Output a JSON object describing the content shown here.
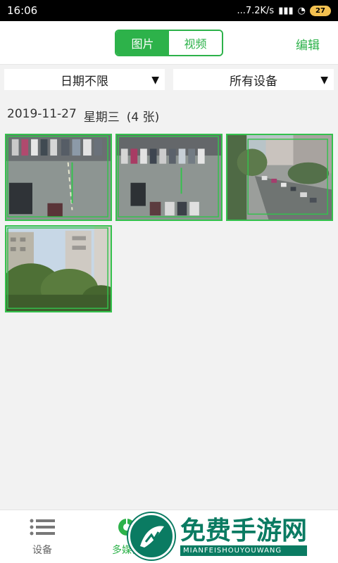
{
  "status_bar": {
    "time": "16:06",
    "network_speed": "...7.2K/s",
    "battery_level": "27"
  },
  "header": {
    "tabs": [
      {
        "label": "图片",
        "active": true
      },
      {
        "label": "视频",
        "active": false
      }
    ],
    "edit_label": "编辑"
  },
  "filters": {
    "date_filter": "日期不限",
    "device_filter": "所有设备"
  },
  "gallery": {
    "date": "2019-11-27",
    "weekday": "星期三",
    "count_label": "(4 张)",
    "items": [
      {
        "type": "photo",
        "scene": "parking-lot"
      },
      {
        "type": "photo",
        "scene": "parking-lot"
      },
      {
        "type": "photo",
        "scene": "street-buildings"
      },
      {
        "type": "photo",
        "scene": "buildings-trees"
      }
    ]
  },
  "bottom_nav": {
    "items": [
      {
        "label": "设备",
        "icon": "list-icon",
        "active": false
      },
      {
        "label": "多媒体",
        "icon": "media-icon",
        "active": true
      },
      {
        "label": "",
        "icon": "",
        "active": false
      },
      {
        "label": "",
        "icon": "",
        "active": false
      }
    ]
  },
  "watermark": {
    "title": "免费手游网",
    "subtitle": "MIANFEISHOUYOUWANG"
  },
  "colors": {
    "accent": "#2db24a",
    "detection_box": "#34c24d"
  }
}
